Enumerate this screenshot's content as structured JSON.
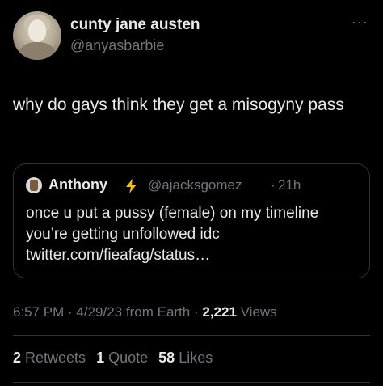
{
  "author": {
    "display_name": "cunty jane austen",
    "handle": "@anyasbarbie",
    "avatar_icon": "profile-photo-avatar"
  },
  "menu": {
    "icon": "more-options-icon",
    "glyph": "···"
  },
  "tweet": {
    "text": "why do gays think they get a misogyny pass"
  },
  "quoted_tweet": {
    "display_name": "Anthony",
    "badge_icon": "lightning-bolt-icon",
    "handle": "@ajacksgomez",
    "separator": "·",
    "time": "21h",
    "text": "once u put a pussy (female) on my timeline you’re getting unfollowed idc twitter.com/fieafag/status…"
  },
  "meta": {
    "time": "6:57 PM",
    "sep1": " · ",
    "date": "4/29/23",
    "source": " from Earth",
    "sep2": " · ",
    "views_count": "2,221",
    "views_label": " Views"
  },
  "stats": {
    "retweets_count": "2",
    "retweets_label": " Retweets",
    "quotes_count": "1",
    "quotes_label": " Quote",
    "likes_count": "58",
    "likes_label": " Likes"
  },
  "colors": {
    "background": "#000000",
    "text": "#e7e9ea",
    "secondary": "#71767b",
    "border": "#2f3336",
    "bolt": "#f5c400"
  }
}
